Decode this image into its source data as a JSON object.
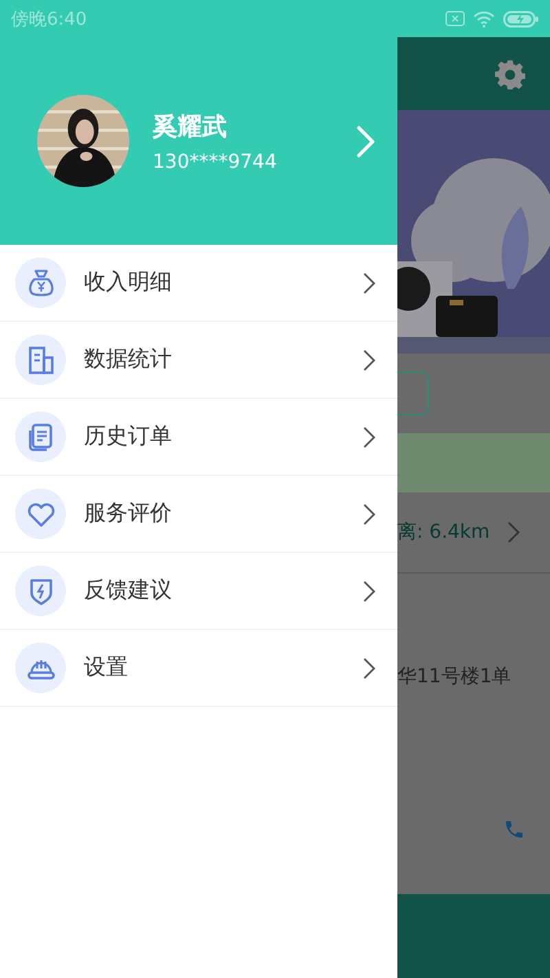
{
  "status_bar": {
    "time": "傍晚6:40"
  },
  "drawer": {
    "profile": {
      "name": "奚耀武",
      "phone": "130****9744"
    },
    "menu": [
      {
        "label": "收入明细"
      },
      {
        "label": "数据统计"
      },
      {
        "label": "历史订单"
      },
      {
        "label": "服务评价"
      },
      {
        "label": "反馈建议"
      },
      {
        "label": "设置"
      }
    ]
  },
  "background": {
    "distance": "离: 6.4km",
    "address": "华11号楼1单"
  }
}
